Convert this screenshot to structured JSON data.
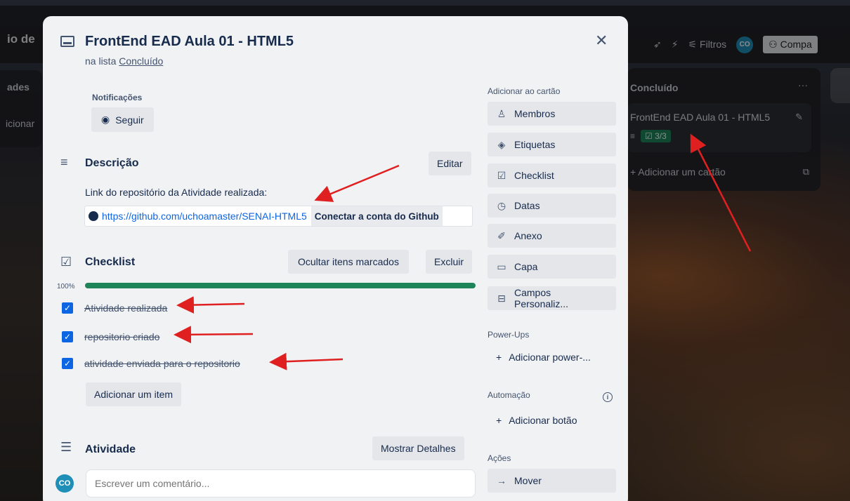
{
  "board": {
    "title": "io de",
    "filters_label": "Filtros",
    "avatar": "CO",
    "share_label": "Compa",
    "left_column": {
      "title": "ades",
      "add_text": "icionar"
    },
    "right_column": {
      "title": "Concluído",
      "menu": "···",
      "card_title": "FrontEnd EAD Aula 01 - HTML5",
      "checklist_badge": "3/3",
      "add_card": "Adicionar um cartão"
    }
  },
  "modal": {
    "title": "FrontEnd EAD Aula 01 - HTML5",
    "list_prefix": "na lista",
    "list_name": "Concluído",
    "notifications_label": "Notificações",
    "follow_label": "Seguir",
    "description": {
      "title": "Descrição",
      "edit_label": "Editar",
      "text": "Link do repositório da Atividade realizada:",
      "link": "https://github.com/uchoamaster/SENAI-HTML5",
      "connect_label": "Conectar a conta do Github"
    },
    "checklist": {
      "title": "Checklist",
      "hide_label": "Ocultar itens marcados",
      "delete_label": "Excluir",
      "percent": "100%",
      "progress": 1.0,
      "items": [
        {
          "text": "Atividade realizada",
          "checked": true
        },
        {
          "text": "repositorio criado",
          "checked": true
        },
        {
          "text": "atividade enviada para o repositorio",
          "checked": true
        }
      ],
      "add_item_label": "Adicionar um item"
    },
    "activity": {
      "title": "Atividade",
      "details_label": "Mostrar Detalhes",
      "avatar": "CO",
      "comment_placeholder": "Escrever um comentário..."
    },
    "sidebar": {
      "add_to_card_label": "Adicionar ao cartão",
      "add_buttons": [
        {
          "icon": "person-icon",
          "label": "Membros"
        },
        {
          "icon": "tag-icon",
          "label": "Etiquetas"
        },
        {
          "icon": "checklist-icon",
          "label": "Checklist"
        },
        {
          "icon": "clock-icon",
          "label": "Datas"
        },
        {
          "icon": "paperclip-icon",
          "label": "Anexo"
        },
        {
          "icon": "card-cover-icon",
          "label": "Capa"
        },
        {
          "icon": "custom-fields-icon",
          "label": "Campos Personaliz..."
        }
      ],
      "powerups_label": "Power-Ups",
      "add_powerup_label": "Adicionar power-...",
      "automation_label": "Automação",
      "add_button_label": "Adicionar botão",
      "actions_label": "Ações",
      "move_label": "Mover"
    }
  },
  "colors": {
    "progress": "#1f845a",
    "checkbox": "#0c66e4",
    "annotation_arrow": "#e02020"
  }
}
